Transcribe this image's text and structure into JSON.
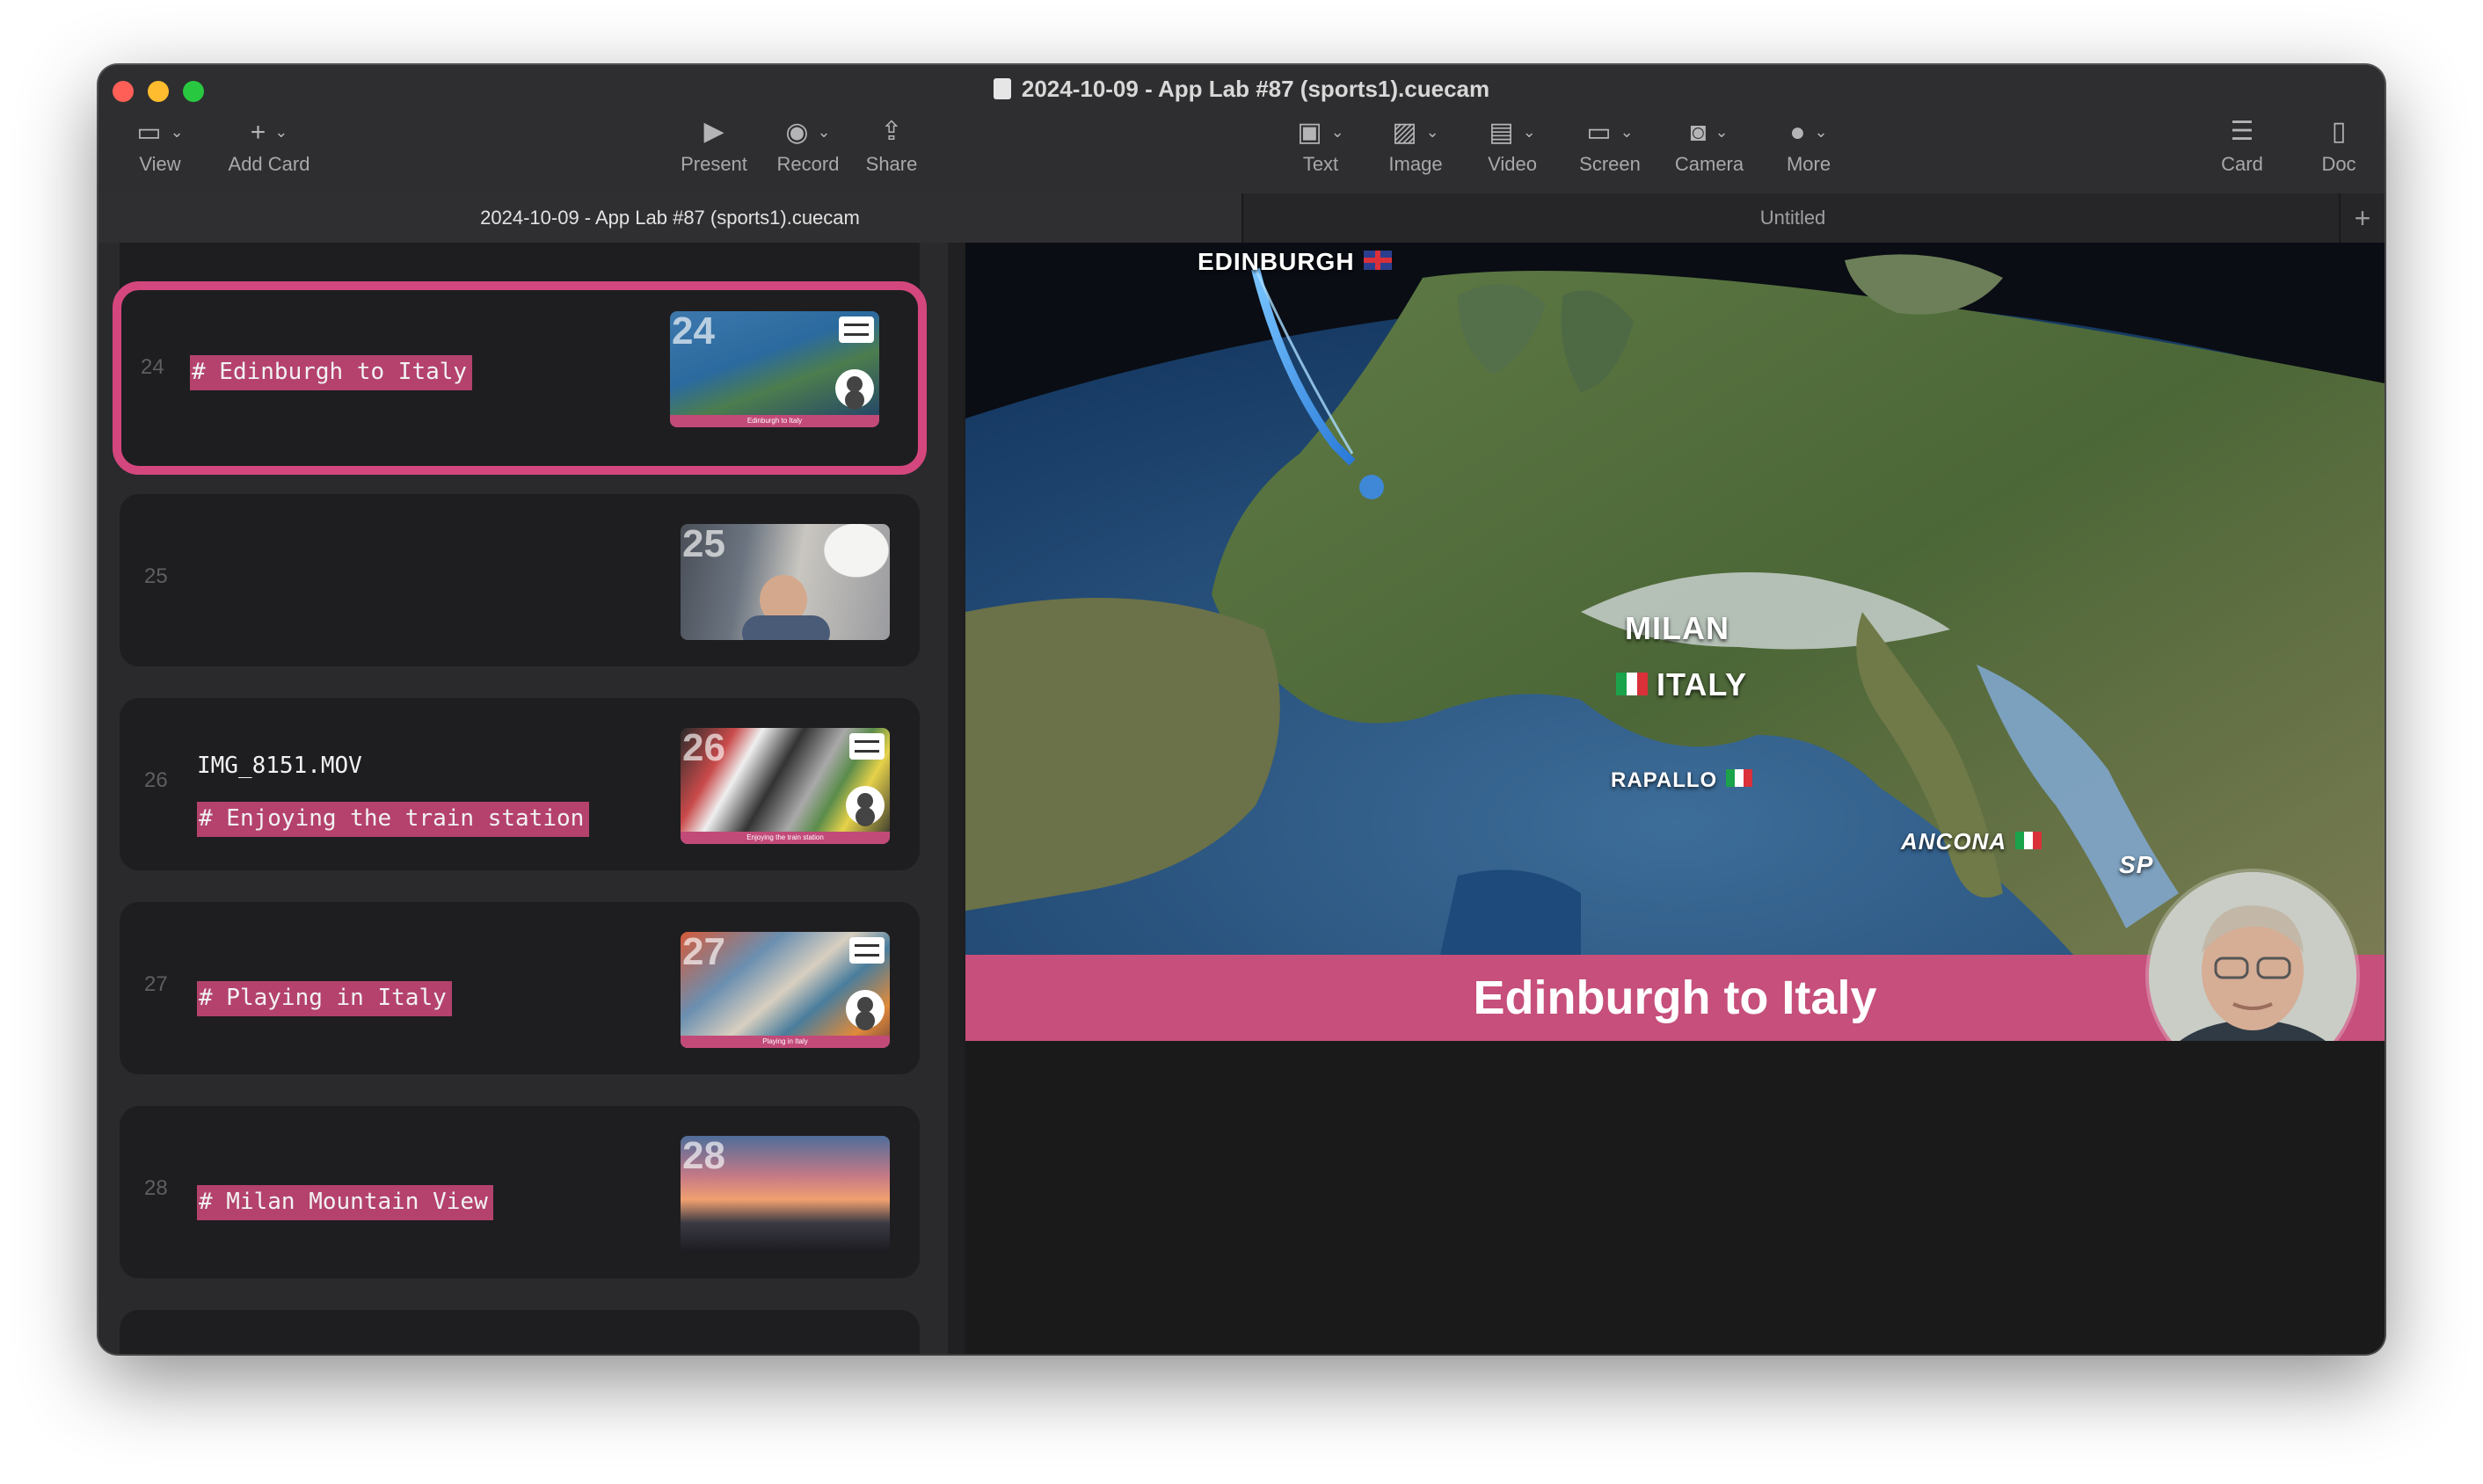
{
  "window": {
    "title": "2024-10-09 - App Lab #87 (sports1).cuecam"
  },
  "toolbar": {
    "view": "View",
    "add_card": "Add Card",
    "present": "Present",
    "record": "Record",
    "share": "Share",
    "text": "Text",
    "image": "Image",
    "video": "Video",
    "screen": "Screen",
    "camera": "Camera",
    "more": "More",
    "card": "Card",
    "doc": "Doc"
  },
  "tabs": [
    {
      "label": "2024-10-09 - App Lab #87 (sports1).cuecam"
    },
    {
      "label": "Untitled"
    }
  ],
  "cards": [
    {
      "number": "24",
      "lines": [],
      "heading": "# Edinburgh to Italy",
      "thumb_number": "24",
      "thumb_caption": "Edinburgh to Italy",
      "selected": true
    },
    {
      "number": "25",
      "lines": [],
      "heading": "",
      "thumb_number": "25",
      "thumb_caption": ""
    },
    {
      "number": "26",
      "filename": "IMG_8151.MOV",
      "heading": "# Enjoying the train station",
      "thumb_number": "26",
      "thumb_caption": "Enjoying the train station"
    },
    {
      "number": "27",
      "heading": "# Playing in Italy",
      "thumb_number": "27",
      "thumb_caption": "Playing in Italy"
    },
    {
      "number": "28",
      "heading": "# Milan Mountain View",
      "thumb_number": "28",
      "thumb_caption": ""
    }
  ],
  "preview": {
    "caption": "Edinburgh to Italy",
    "map_labels": {
      "edinburgh": "EDINBURGH",
      "milan": "MILAN",
      "italy": "ITALY",
      "rapallo": "RAPALLO",
      "ancona": "ANCONA",
      "sp": "SP"
    }
  },
  "colors": {
    "accent": "#d4477e",
    "caption_bar": "#c64f7b",
    "window_bg": "#1e1e1f"
  }
}
